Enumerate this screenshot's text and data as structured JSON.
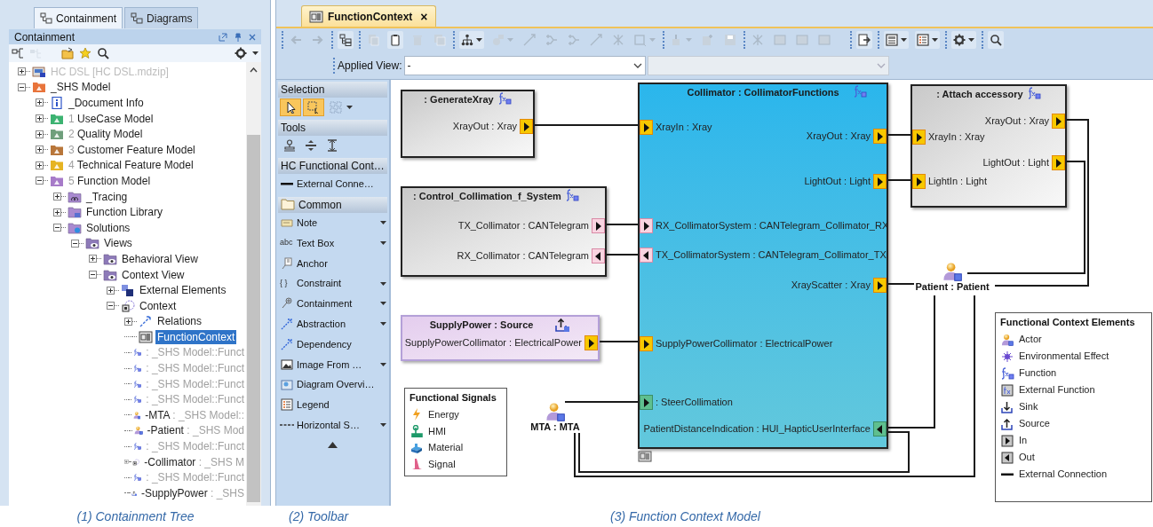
{
  "left_panel": {
    "tabs": [
      {
        "label": "Containment",
        "selected": true
      },
      {
        "label": "Diagrams",
        "selected": false
      }
    ],
    "title": "Containment",
    "tools": [
      {
        "kind": "collapse",
        "disabled": false
      },
      {
        "kind": "expand",
        "disabled": true
      },
      {
        "kind": "folder",
        "disabled": false
      },
      {
        "kind": "star",
        "disabled": false
      },
      {
        "kind": "search",
        "disabled": false
      }
    ],
    "tree": [
      {
        "label": "HC DSL [HC DSL.mdzip]",
        "kind": "project",
        "expanded": false,
        "selected": false,
        "muted": true
      },
      {
        "label": "_SHS Model",
        "kind": "package",
        "color": "#e8743b",
        "expanded": true,
        "selected": false,
        "muted": false,
        "children": [
          {
            "label": "_Document Info",
            "kind": "document",
            "expanded": false,
            "selected": false,
            "muted": false
          },
          {
            "prefix": "1",
            "label": "UseCase Model",
            "kind": "package",
            "color": "#3cb371",
            "expanded": false,
            "selected": false,
            "muted": false
          },
          {
            "prefix": "2",
            "label": "Quality Model",
            "kind": "package",
            "color": "#6f9f7c",
            "expanded": false,
            "selected": false,
            "muted": false
          },
          {
            "prefix": "3",
            "label": "Customer Feature Model",
            "kind": "package",
            "color": "#b8763a",
            "expanded": false,
            "selected": false,
            "muted": false
          },
          {
            "prefix": "4",
            "label": "Technical Feature Model",
            "kind": "package",
            "color": "#e6b422",
            "expanded": false,
            "selected": false,
            "muted": false
          },
          {
            "prefix": "5",
            "label": "Function Model",
            "kind": "package",
            "color": "#a77bc9",
            "expanded": true,
            "selected": false,
            "muted": false,
            "children": [
              {
                "label": "_Tracing",
                "kind": "tracing",
                "expanded": false,
                "selected": false,
                "muted": false
              },
              {
                "label": "Function Library",
                "kind": "library",
                "expanded": false,
                "selected": false,
                "muted": false
              },
              {
                "label": "Solutions",
                "kind": "solutions",
                "expanded": true,
                "selected": false,
                "muted": false,
                "children": [
                  {
                    "label": "Views",
                    "kind": "views",
                    "expanded": true,
                    "selected": false,
                    "muted": false,
                    "children": [
                      {
                        "label": "Behavioral View",
                        "kind": "view",
                        "expanded": false,
                        "selected": false,
                        "muted": false
                      },
                      {
                        "label": "Context View",
                        "kind": "view",
                        "expanded": true,
                        "selected": false,
                        "muted": false,
                        "children": [
                          {
                            "label": "External Elements",
                            "kind": "elements",
                            "expanded": false,
                            "selected": false,
                            "muted": false
                          },
                          {
                            "label": "Context",
                            "kind": "context",
                            "expanded": true,
                            "selected": false,
                            "muted": false,
                            "children": [
                              {
                                "label": "Relations",
                                "kind": "relations",
                                "expanded": false,
                                "selected": false,
                                "muted": false
                              },
                              {
                                "label": "FunctionContext",
                                "kind": "diagram",
                                "selected": true,
                                "muted": false
                              },
                              {
                                "type": ": _SHS Model::Funct",
                                "kind": "function",
                                "selected": false,
                                "muted": false
                              },
                              {
                                "type": ": _SHS Model::Funct",
                                "kind": "function",
                                "selected": false,
                                "muted": false
                              },
                              {
                                "type": ": _SHS Model::Funct",
                                "kind": "function",
                                "selected": false,
                                "muted": false
                              },
                              {
                                "type": ": _SHS Model::Funct",
                                "kind": "function",
                                "selected": false,
                                "muted": false
                              },
                              {
                                "label": "-MTA",
                                "type": " : _SHS Model::",
                                "kind": "actor",
                                "selected": false,
                                "muted": false
                              },
                              {
                                "label": "-Patient",
                                "type": " : _SHS Mod",
                                "kind": "actor",
                                "selected": false,
                                "muted": false
                              },
                              {
                                "type": ": _SHS Model::Funct",
                                "kind": "function",
                                "selected": false,
                                "muted": false
                              },
                              {
                                "label": "-Collimator",
                                "type": " : _SHS M",
                                "kind": "part",
                                "expanded": false,
                                "selected": false,
                                "muted": false
                              },
                              {
                                "type": ": _SHS Model::Funct",
                                "kind": "function",
                                "selected": false,
                                "muted": false
                              },
                              {
                                "label": "-SupplyPower",
                                "type": " : _SHS",
                                "kind": "source",
                                "selected": false,
                                "muted": false
                              }
                            ]
                          }
                        ]
                      }
                    ]
                  }
                ]
              }
            ]
          }
        ]
      }
    ]
  },
  "editor_tab": {
    "title": "FunctionContext",
    "close": "×"
  },
  "toolbar": [
    [
      {
        "kind": "back",
        "disabled": true,
        "menu": false
      },
      {
        "kind": "forward",
        "disabled": true,
        "menu": false
      }
    ],
    [
      {
        "kind": "tree",
        "disabled": false,
        "menu": false
      }
    ],
    [
      {
        "kind": "copy",
        "disabled": true,
        "menu": false
      },
      {
        "kind": "clipboard",
        "disabled": false,
        "menu": false
      },
      {
        "kind": "trash",
        "disabled": true,
        "menu": false
      },
      {
        "kind": "stack",
        "disabled": true,
        "menu": false
      }
    ],
    [
      {
        "kind": "hierarchy",
        "disabled": false,
        "menu": true
      },
      {
        "kind": "shape",
        "disabled": true,
        "menu": true
      },
      {
        "kind": "line",
        "disabled": true,
        "menu": false
      },
      {
        "kind": "fork",
        "disabled": true,
        "menu": false
      },
      {
        "kind": "fork",
        "disabled": true,
        "menu": false
      },
      {
        "kind": "line",
        "disabled": true,
        "menu": false
      },
      {
        "kind": "cross",
        "disabled": true,
        "menu": false
      },
      {
        "kind": "frame",
        "disabled": true,
        "menu": true
      }
    ],
    [
      {
        "kind": "paint",
        "disabled": true,
        "menu": true
      },
      {
        "kind": "note",
        "disabled": true,
        "menu": false
      },
      {
        "kind": "save",
        "disabled": true,
        "menu": false
      }
    ],
    [
      {
        "kind": "cross",
        "disabled": true,
        "menu": false
      },
      {
        "kind": "block",
        "disabled": true,
        "menu": false
      },
      {
        "kind": "block",
        "disabled": true,
        "menu": false
      },
      {
        "kind": "block",
        "disabled": true,
        "menu": false
      }
    ],
    [
      {
        "kind": "export",
        "disabled": false,
        "menu": false
      }
    ],
    [
      {
        "kind": "layout",
        "disabled": false,
        "menu": true
      },
      {
        "kind": "list",
        "disabled": false,
        "menu": true
      }
    ],
    [
      {
        "kind": "gear",
        "disabled": false,
        "menu": true
      }
    ],
    [
      {
        "kind": "search",
        "disabled": false,
        "menu": false
      }
    ]
  ],
  "applied_view": {
    "label": "Applied View:",
    "combos": [
      {
        "value": "-",
        "disabled": false
      },
      {
        "disabled": true
      }
    ]
  },
  "palette": [
    {
      "title": "Selection",
      "kind": "icons",
      "items": [
        {
          "kind": "pointer",
          "selected": true,
          "menu": false
        },
        {
          "kind": "marquee",
          "selected": true,
          "menu": false
        },
        {
          "kind": "grid",
          "selected": false,
          "menu": true
        }
      ]
    },
    {
      "title": "Tools",
      "kind": "icons",
      "items": [
        {
          "kind": "stamp",
          "selected": false,
          "menu": false
        },
        {
          "kind": "split",
          "selected": false,
          "menu": false
        },
        {
          "kind": "spread",
          "selected": false,
          "menu": false
        }
      ]
    },
    {
      "title": "HC Functional Cont…",
      "kind": "list",
      "folder": false,
      "items": [
        {
          "kind": "connector",
          "label": "External Conne…",
          "menu": false
        }
      ]
    },
    {
      "title": "Common",
      "kind": "list",
      "folder": true,
      "items": [
        {
          "kind": "note",
          "label": "Note",
          "menu": true
        },
        {
          "glyph": "abc",
          "label": "Text Box",
          "menu": true
        },
        {
          "kind": "anchor",
          "label": "Anchor",
          "menu": false
        },
        {
          "glyph": "{ }",
          "label": "Constraint",
          "menu": true
        },
        {
          "kind": "containment",
          "label": "Containment",
          "menu": true
        },
        {
          "kind": "abstraction",
          "label": "Abstraction",
          "menu": true
        },
        {
          "kind": "dependency",
          "label": "Dependency",
          "menu": false
        },
        {
          "kind": "image",
          "label": "Image From …",
          "menu": true
        },
        {
          "kind": "overview",
          "label": "Diagram Overvi…",
          "menu": false
        },
        {
          "kind": "legend",
          "label": "Legend",
          "menu": false
        },
        {
          "kind": "separator",
          "label": "Horizontal S…",
          "menu": true
        }
      ]
    }
  ],
  "diagram": {
    "nodes": [
      {
        "kind": "function",
        "title": ": GenerateXray",
        "right_ports": [
          {
            "label": "XrayOut : Xray",
            "kind": "energy",
            "incoming": false
          }
        ]
      },
      {
        "kind": "part",
        "title": "Collimator : CollimatorFunctions",
        "left_ports": [
          {
            "label": "XrayIn : Xray",
            "kind": "energy",
            "incoming": true
          },
          {
            "label": "RX_CollimatorSystem : CANTelegram_Collimator_RX",
            "kind": "signal",
            "incoming": true
          },
          {
            "label": "TX_CollimatorSystem : CANTelegram_Collimator_TX",
            "kind": "signal",
            "incoming": false
          },
          {
            "label": "SupplyPowerCollimator : ElectricalPower",
            "kind": "energy",
            "incoming": true
          },
          {
            "label": ": SteerCollimation",
            "kind": "hmi",
            "incoming": true
          }
        ],
        "right_ports": [
          {
            "label": "XrayOut : Xray",
            "kind": "energy",
            "incoming": false
          },
          {
            "label": "LightOut : Light",
            "kind": "energy",
            "incoming": false
          },
          {
            "label": "XrayScatter : Xray",
            "kind": "energy",
            "incoming": false
          },
          {
            "label": "PatientDistanceIndication : HUI_HapticUserInterface",
            "kind": "hmi",
            "incoming": true
          }
        ]
      },
      {
        "kind": "function",
        "title": ": Attach accessory",
        "left_ports": [
          {
            "label": "XrayIn : Xray",
            "kind": "energy",
            "incoming": true
          },
          {
            "label": "LightIn : Light",
            "kind": "energy",
            "incoming": true
          }
        ],
        "right_ports": [
          {
            "label": "XrayOut : Xray",
            "kind": "energy",
            "incoming": false
          },
          {
            "label": "LightOut : Light",
            "kind": "energy",
            "incoming": false
          }
        ]
      },
      {
        "kind": "function",
        "title": ": Control_Collimation_f_System",
        "right_ports": [
          {
            "label": "TX_Collimator : CANTelegram",
            "kind": "signal",
            "incoming": false
          },
          {
            "label": "RX_Collimator : CANTelegram",
            "kind": "signal",
            "incoming": true
          }
        ]
      },
      {
        "kind": "source",
        "title": "SupplyPower : Source",
        "right_ports": [
          {
            "label": "SupplyPowerCollimator : ElectricalPower",
            "kind": "energy",
            "incoming": false
          }
        ]
      }
    ],
    "actors": [
      {
        "label": "Patient : Patient"
      },
      {
        "label": "MTA : MTA"
      }
    ],
    "legends": [
      {
        "title": "Functional Signals",
        "items": [
          {
            "kind": "energy",
            "label": "Energy"
          },
          {
            "kind": "hmi",
            "label": "HMI"
          },
          {
            "kind": "material",
            "label": "Material"
          },
          {
            "kind": "signal",
            "label": "Signal"
          }
        ]
      },
      {
        "title": "Functional Context Elements",
        "items": [
          {
            "kind": "actor",
            "label": "Actor"
          },
          {
            "kind": "effect",
            "label": "Environmental Effect"
          },
          {
            "kind": "function",
            "label": "Function"
          },
          {
            "kind": "external",
            "label": "External Function"
          },
          {
            "kind": "sink",
            "label": "Sink"
          },
          {
            "kind": "source",
            "label": "Source"
          },
          {
            "kind": "in",
            "label": "In"
          },
          {
            "kind": "out",
            "label": "Out"
          },
          {
            "kind": "connection",
            "label": "External Connection"
          }
        ]
      }
    ]
  },
  "captions": [
    "(1) Containment Tree",
    "(2) Toolbar",
    "(3) Function Context Model"
  ]
}
